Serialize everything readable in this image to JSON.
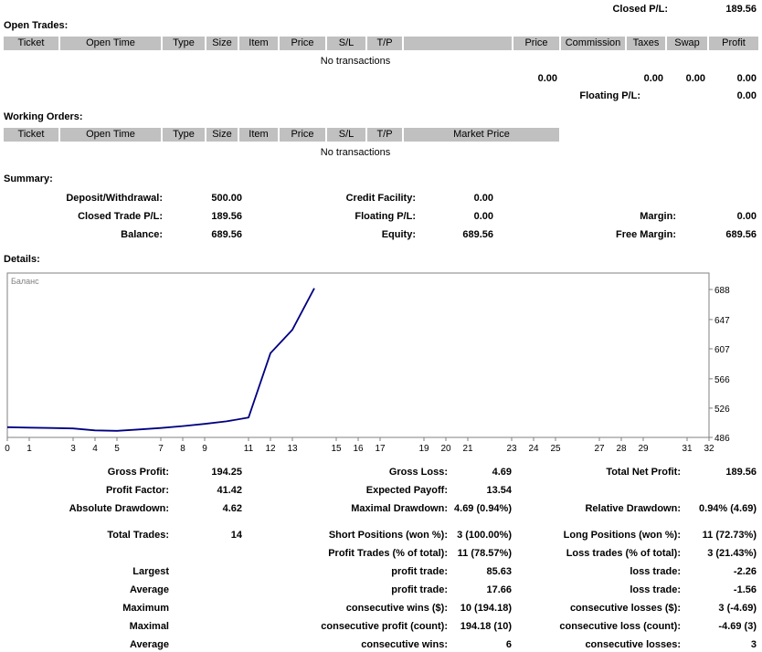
{
  "top": {
    "closed_pl_label": "Closed P/L:",
    "closed_pl_value": "189.56"
  },
  "open_trades": {
    "title": "Open Trades:",
    "columns": {
      "ticket": "Ticket",
      "open_time": "Open Time",
      "type": "Type",
      "size": "Size",
      "item": "Item",
      "price": "Price",
      "sl": "S/L",
      "tp": "T/P",
      "price2": "Price",
      "commission": "Commission",
      "taxes": "Taxes",
      "swap": "Swap",
      "profit": "Profit"
    },
    "empty_message": "No transactions",
    "totals": {
      "price": "0.00",
      "taxes": "0.00",
      "swap": "0.00",
      "profit": "0.00"
    },
    "floating_pl_label": "Floating P/L:",
    "floating_pl_value": "0.00"
  },
  "working_orders": {
    "title": "Working Orders:",
    "columns": {
      "ticket": "Ticket",
      "open_time": "Open Time",
      "type": "Type",
      "size": "Size",
      "item": "Item",
      "price": "Price",
      "sl": "S/L",
      "tp": "T/P",
      "market_price": "Market Price"
    },
    "empty_message": "No transactions"
  },
  "summary": {
    "title": "Summary:",
    "rows": [
      {
        "c1l": "Deposit/Withdrawal:",
        "c1v": "500.00",
        "c2l": "Credit Facility:",
        "c2v": "0.00",
        "c3l": "",
        "c3v": ""
      },
      {
        "c1l": "Closed Trade P/L:",
        "c1v": "189.56",
        "c2l": "Floating P/L:",
        "c2v": "0.00",
        "c3l": "Margin:",
        "c3v": "0.00"
      },
      {
        "c1l": "Balance:",
        "c1v": "689.56",
        "c2l": "Equity:",
        "c2v": "689.56",
        "c3l": "Free Margin:",
        "c3v": "689.56"
      }
    ]
  },
  "details_title": "Details:",
  "chart_data": {
    "type": "line",
    "title": "",
    "legend": "Баланс",
    "x": [
      0,
      1,
      2,
      3,
      4,
      5,
      6,
      7,
      8,
      9,
      10,
      11,
      12,
      13,
      14
    ],
    "values": [
      500,
      499.3,
      498.8,
      498.2,
      495.6,
      495.0,
      496.8,
      498.8,
      501.5,
      504.5,
      508,
      513,
      601,
      633,
      689.56
    ],
    "x_ticks": [
      0,
      1,
      3,
      4,
      5,
      7,
      8,
      9,
      11,
      12,
      13,
      15,
      16,
      17,
      19,
      20,
      21,
      23,
      24,
      25,
      27,
      28,
      29,
      31,
      32
    ],
    "y_ticks": [
      486,
      526,
      566,
      607,
      647,
      688
    ],
    "xlim": [
      0,
      32
    ],
    "ylim": [
      486,
      688
    ],
    "grid": false,
    "legend_position": "top-left",
    "line_color": "#000080"
  },
  "stats": {
    "rows": [
      {
        "c1l": "Gross Profit:",
        "c1v": "194.25",
        "c2l": "Gross Loss:",
        "c2v": "4.69",
        "c3l": "Total Net Profit:",
        "c3v": "189.56"
      },
      {
        "c1l": "Profit Factor:",
        "c1v": "41.42",
        "c2l": "Expected Payoff:",
        "c2v": "13.54",
        "c3l": "",
        "c3v": ""
      },
      {
        "c1l": "Absolute Drawdown:",
        "c1v": "4.62",
        "c2l": "Maximal Drawdown:",
        "c2v": "4.69 (0.94%)",
        "c3l": "Relative Drawdown:",
        "c3v": "0.94% (4.69)"
      },
      {
        "c1l": "Total Trades:",
        "c1v": "14",
        "c2l": "Short Positions (won %):",
        "c2v": "3 (100.00%)",
        "c3l": "Long Positions (won %):",
        "c3v": "11 (72.73%)"
      },
      {
        "c1l": "",
        "c1v": "",
        "c2l": "Profit Trades (% of total):",
        "c2v": "11 (78.57%)",
        "c3l": "Loss trades (% of total):",
        "c3v": "3 (21.43%)"
      },
      {
        "c1l": "Largest",
        "c1v": "",
        "c2l": "profit trade:",
        "c2v": "85.63",
        "c3l": "loss trade:",
        "c3v": "-2.26"
      },
      {
        "c1l": "Average",
        "c1v": "",
        "c2l": "profit trade:",
        "c2v": "17.66",
        "c3l": "loss trade:",
        "c3v": "-1.56"
      },
      {
        "c1l": "Maximum",
        "c1v": "",
        "c2l": "consecutive wins ($):",
        "c2v": "10 (194.18)",
        "c3l": "consecutive losses ($):",
        "c3v": "3 (-4.69)"
      },
      {
        "c1l": "Maximal",
        "c1v": "",
        "c2l": "consecutive profit (count):",
        "c2v": "194.18 (10)",
        "c3l": "consecutive loss (count):",
        "c3v": "-4.69 (3)"
      },
      {
        "c1l": "Average",
        "c1v": "",
        "c2l": "consecutive wins:",
        "c2v": "6",
        "c3l": "consecutive losses:",
        "c3v": "3"
      }
    ]
  }
}
